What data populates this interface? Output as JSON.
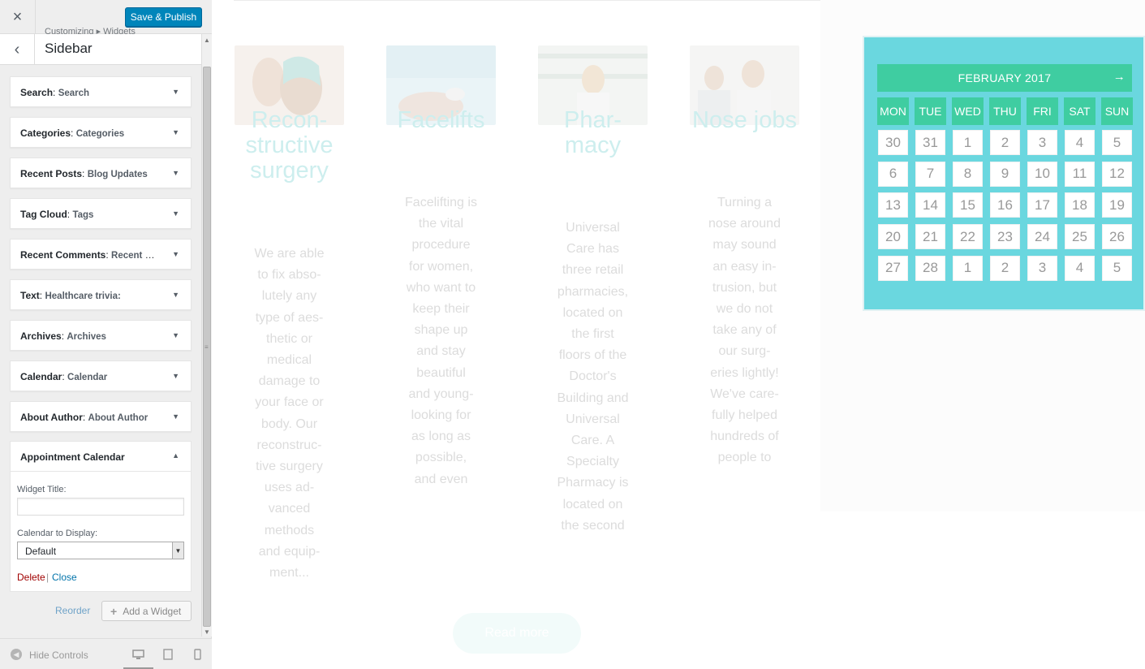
{
  "customizer": {
    "close_icon": "×",
    "save_label": "Save & Publish",
    "back_icon": "‹",
    "breadcrumb": "Customizing ▸ Widgets",
    "section_title": "Sidebar",
    "widgets": [
      {
        "type": "Search",
        "title": "Search"
      },
      {
        "type": "Categories",
        "title": "Categories"
      },
      {
        "type": "Recent Posts",
        "title": "Blog Updates"
      },
      {
        "type": "Tag Cloud",
        "title": "Tags"
      },
      {
        "type": "Recent Comments",
        "title": "Recent Co..."
      },
      {
        "type": "Text",
        "title": "Healthcare trivia:"
      },
      {
        "type": "Archives",
        "title": "Archives"
      },
      {
        "type": "Calendar",
        "title": "Calendar"
      },
      {
        "type": "About Author",
        "title": "About Author"
      }
    ],
    "appointment": {
      "title": "Appointment Calendar",
      "widget_title_label": "Widget Title:",
      "widget_title_value": "",
      "calendar_label": "Calendar to Display:",
      "calendar_value": "Default",
      "delete_label": "Delete",
      "separator": "|",
      "close_label": "Close"
    },
    "reorder_label": "Reorder",
    "add_widget_label": "Add a Widget",
    "footer": {
      "hide_controls_label": "Hide Controls",
      "devices": [
        "desktop",
        "tablet",
        "mobile"
      ],
      "active_device": "desktop"
    }
  },
  "preview": {
    "services": [
      {
        "title": "Recon-\nstructive\nsurgery",
        "text": "We are able\nto fix abso-\nlutely any\ntype of aes-\nthetic or\nmedical\ndamage to\nyour face or\nbody. Our\nreconstruc-\ntive surgery\nuses ad-\nvanced\nmethods\nand equip-\nment..."
      },
      {
        "title": "Facelifts",
        "text": "Facelifting is\nthe vital\nprocedure\nfor women,\nwho want to\nkeep their\nshape up\nand stay\nbeautiful\nand young-\nlooking for\nas long as\npossible,\nand even"
      },
      {
        "title": "Phar-\nmacy",
        "text": "Universal\nCare has\nthree retail\npharmacies,\nlocated on\nthe first\nfloors of the\nDoctor's\nBuilding and\nUniversal\nCare. A\nSpecialty\nPharmacy is\nlocated on\nthe second"
      },
      {
        "title": "Nose jobs",
        "text": "Turning a\nnose around\nmay sound\nan easy in-\ntrusion, but\nwe do not\ntake any of\nour surg-\neries lightly!\nWe've care-\nfully helped\nhundreds of\npeople to"
      }
    ],
    "read_more_label": "Read more",
    "calendar": {
      "month_label": "FEBRUARY 2017",
      "next_icon": "→",
      "days_of_week": [
        "MON",
        "TUE",
        "WED",
        "THU",
        "FRI",
        "SAT",
        "SUN"
      ],
      "weeks": [
        [
          "30",
          "31",
          "1",
          "2",
          "3",
          "4",
          "5"
        ],
        [
          "6",
          "7",
          "8",
          "9",
          "10",
          "11",
          "12"
        ],
        [
          "13",
          "14",
          "15",
          "16",
          "17",
          "18",
          "19"
        ],
        [
          "20",
          "21",
          "22",
          "23",
          "24",
          "25",
          "26"
        ],
        [
          "27",
          "28",
          "1",
          "2",
          "3",
          "4",
          "5"
        ]
      ]
    }
  },
  "colors": {
    "save_button": "#0085ba",
    "calendar_bg": "#6ad7df",
    "calendar_header": "#3fcda1",
    "service_title": "#cdeeee",
    "delete_link": "#a00000",
    "close_link": "#0073aa"
  }
}
